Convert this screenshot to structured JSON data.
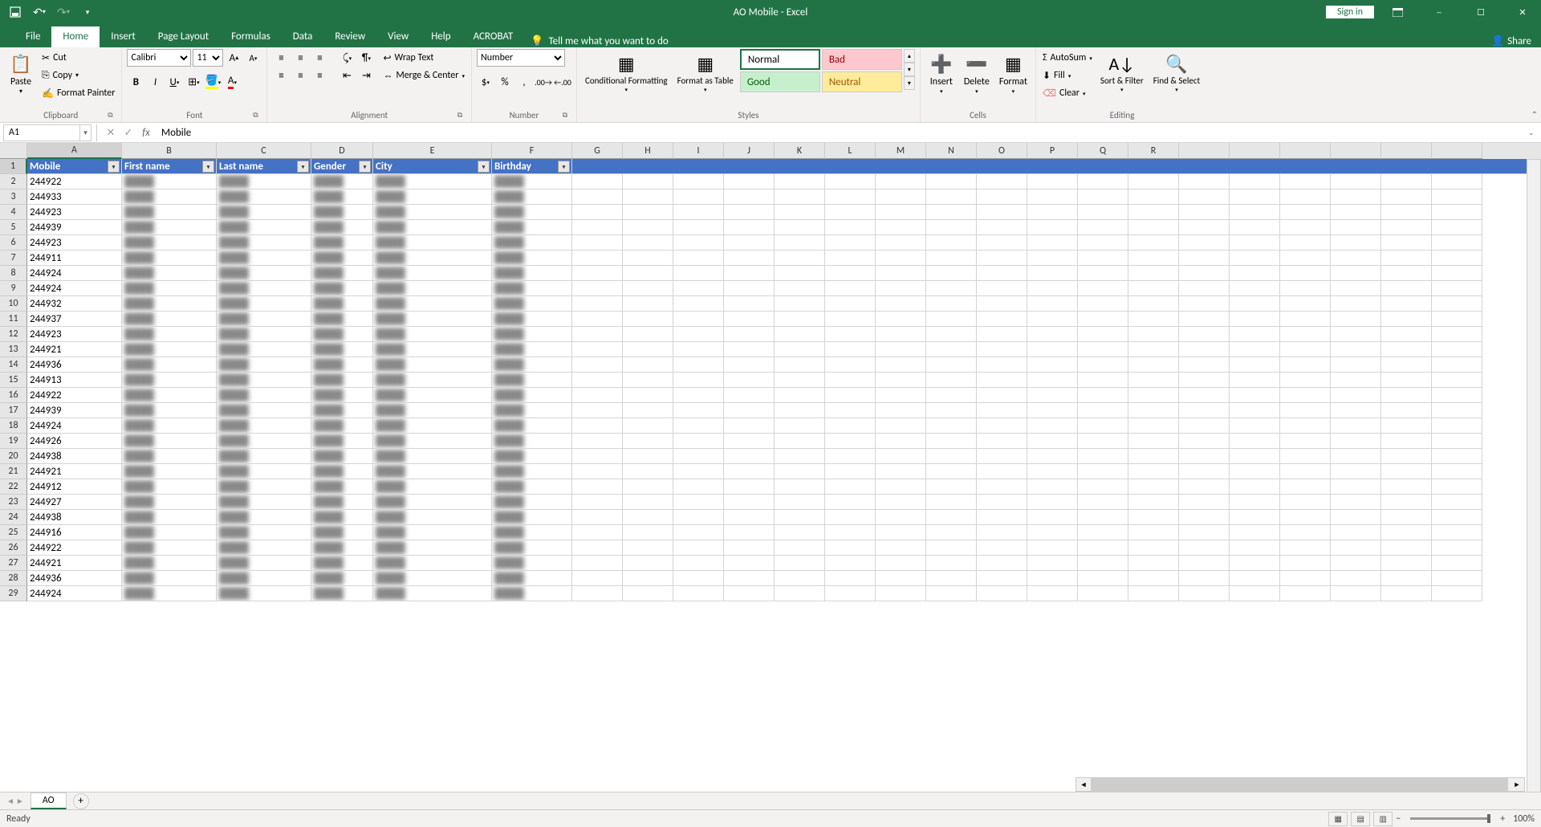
{
  "title": "AO Mobile - Excel",
  "signin": "Sign in",
  "tabs": {
    "file": "File",
    "home": "Home",
    "insert": "Insert",
    "page": "Page Layout",
    "formulas": "Formulas",
    "data": "Data",
    "review": "Review",
    "view": "View",
    "help": "Help",
    "acrobat": "ACROBAT",
    "tellme": "Tell me what you want to do",
    "share": "Share"
  },
  "clipboard": {
    "paste": "Paste",
    "cut": "Cut",
    "copy": "Copy",
    "format_painter": "Format Painter",
    "label": "Clipboard"
  },
  "font": {
    "name": "Calibri",
    "size": "11",
    "label": "Font"
  },
  "alignment": {
    "wrap": "Wrap Text",
    "merge": "Merge & Center",
    "label": "Alignment"
  },
  "number": {
    "format": "Number",
    "label": "Number"
  },
  "styles": {
    "conditional": "Conditional Formatting",
    "format_table": "Format as Table",
    "normal": "Normal",
    "bad": "Bad",
    "good": "Good",
    "neutral": "Neutral",
    "label": "Styles"
  },
  "cells": {
    "insert": "Insert",
    "delete": "Delete",
    "format": "Format",
    "label": "Cells"
  },
  "editing": {
    "autosum": "AutoSum",
    "fill": "Fill",
    "clear": "Clear",
    "sort": "Sort & Filter",
    "find": "Find & Select",
    "label": "Editing"
  },
  "namebox": "A1",
  "formula": "Mobile",
  "columns": [
    "A",
    "B",
    "C",
    "D",
    "E",
    "F",
    "G",
    "H",
    "I",
    "J",
    "K",
    "L",
    "M",
    "N",
    "O",
    "P",
    "Q",
    "R"
  ],
  "headers": {
    "mobile": "Mobile",
    "first": "First name",
    "last": "Last name",
    "gender": "Gender",
    "city": "City",
    "birthday": "Birthday"
  },
  "rows": [
    {
      "n": 2,
      "m": "244922"
    },
    {
      "n": 3,
      "m": "244933"
    },
    {
      "n": 4,
      "m": "244923"
    },
    {
      "n": 5,
      "m": "244939"
    },
    {
      "n": 6,
      "m": "244923"
    },
    {
      "n": 7,
      "m": "244911"
    },
    {
      "n": 8,
      "m": "244924"
    },
    {
      "n": 9,
      "m": "244924"
    },
    {
      "n": 10,
      "m": "244932"
    },
    {
      "n": 11,
      "m": "244937"
    },
    {
      "n": 12,
      "m": "244923"
    },
    {
      "n": 13,
      "m": "244921"
    },
    {
      "n": 14,
      "m": "244936"
    },
    {
      "n": 15,
      "m": "244913"
    },
    {
      "n": 16,
      "m": "244922"
    },
    {
      "n": 17,
      "m": "244939"
    },
    {
      "n": 18,
      "m": "244924"
    },
    {
      "n": 19,
      "m": "244926"
    },
    {
      "n": 20,
      "m": "244938"
    },
    {
      "n": 21,
      "m": "244921"
    },
    {
      "n": 22,
      "m": "244912"
    },
    {
      "n": 23,
      "m": "244927"
    },
    {
      "n": 24,
      "m": "244938"
    },
    {
      "n": 25,
      "m": "244916"
    },
    {
      "n": 26,
      "m": "244922"
    },
    {
      "n": 27,
      "m": "244921"
    },
    {
      "n": 28,
      "m": "244936"
    },
    {
      "n": 29,
      "m": "244924"
    }
  ],
  "sheet": "AO",
  "status": "Ready",
  "zoom": "100%"
}
